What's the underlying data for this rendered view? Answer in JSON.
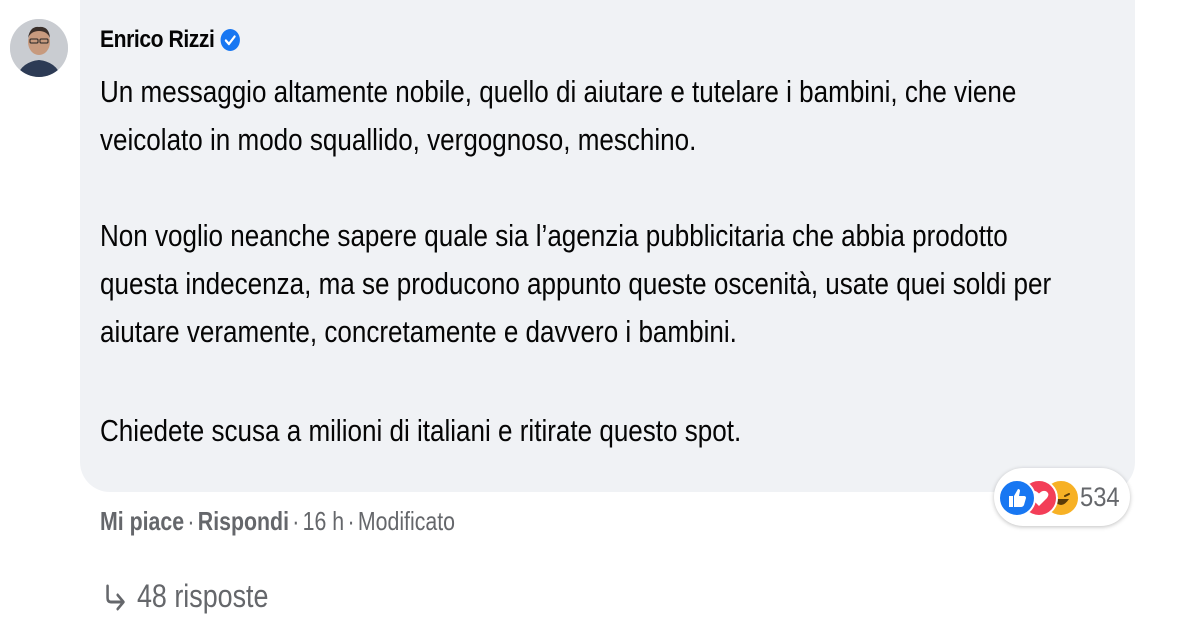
{
  "comment": {
    "author": "Enrico Rizzi",
    "verified_icon": "verified-badge-icon",
    "paragraphs": [
      [
        "Un messaggio altamente nobile, quello di aiutare e tutelare i bambini, che viene",
        "veicolato in modo squallido, vergognoso, meschino."
      ],
      [
        "Non voglio neanche sapere quale sia l’agenzia pubblicitaria che abbia prodotto",
        "questa indecenza, ma se producono appunto queste oscenità, usate quei soldi per",
        "aiutare veramente, concretamente e davvero i bambini."
      ],
      [
        "Chiedete scusa a milioni di italiani e ritirate questo spot."
      ]
    ]
  },
  "actions": {
    "like_label": "Mi piace",
    "reply_label": "Rispondi",
    "time": "16 h",
    "edited": "Modificato",
    "separator": "·"
  },
  "reactions": {
    "icons": [
      "like-icon",
      "love-icon",
      "haha-icon"
    ],
    "count": "534"
  },
  "replies": {
    "label": "48 risposte"
  },
  "colors": {
    "bubble_bg": "#f0f2f5",
    "secondary_text": "#65676b",
    "brand_blue": "#1877f2"
  }
}
